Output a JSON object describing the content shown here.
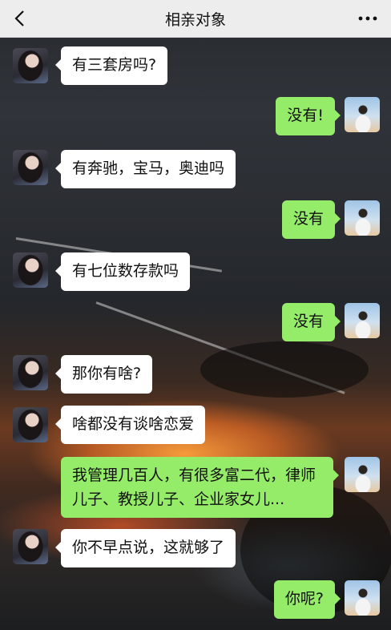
{
  "header": {
    "title": "相亲对象",
    "back_icon": "chevron-left-icon",
    "more_icon": "more-dots-icon"
  },
  "messages": [
    {
      "side": "in",
      "text": "有三套房吗?"
    },
    {
      "side": "out",
      "text": "没有!"
    },
    {
      "side": "in",
      "text": "有奔驰，宝马，奥迪吗"
    },
    {
      "side": "out",
      "text": "没有"
    },
    {
      "side": "in",
      "text": "有七位数存款吗"
    },
    {
      "side": "out",
      "text": "没有"
    },
    {
      "side": "in",
      "text": "那你有啥?"
    },
    {
      "side": "in",
      "text": "啥都没有谈啥恋爱"
    },
    {
      "side": "out",
      "text": "我管理几百人，有很多富二代，律师儿子、教授儿子、企业家女儿..."
    },
    {
      "side": "in",
      "text": "你不早点说，这就够了"
    },
    {
      "side": "out",
      "text": "你呢?"
    }
  ],
  "colors": {
    "incoming_bubble": "#ffffff",
    "outgoing_bubble": "#95ec69",
    "header_bg": "#ededed"
  }
}
